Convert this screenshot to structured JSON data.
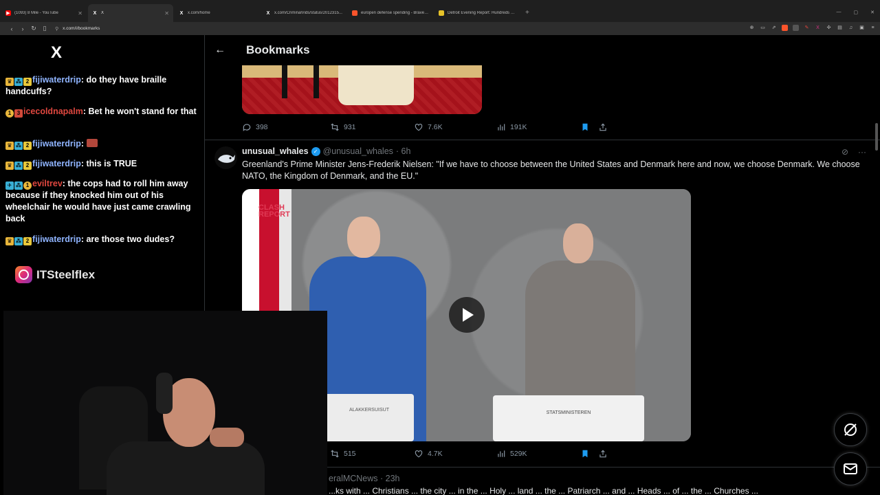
{
  "browser": {
    "tabs": [
      {
        "title": "(1093) 8 Mile - YouTube",
        "icon": "youtube-icon",
        "color": "#ff0000",
        "active": false
      },
      {
        "title": "X",
        "icon": "x-icon",
        "color": "#000000",
        "active": true
      },
      {
        "title": "x.com/home",
        "icon": "x-icon",
        "color": "#000000",
        "active": false
      },
      {
        "title": "x.com/CriminalVids/status/2012315...",
        "icon": "x-icon",
        "color": "#000000",
        "active": false
      },
      {
        "title": "europen defense spending - Brave S...",
        "icon": "brave-search-icon",
        "color": "#fb542b",
        "active": false
      },
      {
        "title": "Detroit Evening Report: Hundreds in...",
        "icon": "news-icon",
        "color": "#e6c229",
        "active": false
      }
    ],
    "url": "x.com/i/bookmarks"
  },
  "chat": {
    "logo": "X",
    "messages": [
      {
        "user": "fijiwaterdrip",
        "user_color": "blue",
        "text": ": do they have braille handcuffs?"
      },
      {
        "user": "icecoldnapalm",
        "user_color": "red",
        "text": ": Bet he won't stand for that"
      },
      {
        "user": "fijiwaterdrip",
        "user_color": "blue",
        "text": ":"
      },
      {
        "user": "fijiwaterdrip",
        "user_color": "blue",
        "text": ": this is TRUE"
      },
      {
        "user": "eviltrev",
        "user_color": "red",
        "text": ": the cops had to roll him away because if they knocked him out of his wheelchair he would have just came crawling back"
      },
      {
        "user": "fijiwaterdrip",
        "user_color": "blue",
        "text": ": are those two dudes?"
      }
    ],
    "instagram_handle": "ITSteelflex"
  },
  "feed": {
    "title": "Bookmarks",
    "previous_tweet": {
      "replies": "398",
      "reposts": "931",
      "likes": "7.6K",
      "views": "191K"
    },
    "tweet": {
      "display_name": "unusual_whales",
      "handle": "@unusual_whales",
      "time": "· 6h",
      "text": "Greenland's Prime Minister Jens-Frederik Nielsen: \"If we have to choose between the United States and Denmark here and now, we choose Denmark. We choose NATO, the Kingdom of Denmark, and the EU.\"",
      "video_logo_line1": "CLASH",
      "video_logo_line2": "REPORT",
      "podium_left": "ALAKKERSUISUT",
      "podium_right": "STATSMINISTEREN",
      "reposts": "515",
      "likes": "4.7K",
      "views": "529K"
    },
    "next_tweet": {
      "handle_fragment": "eralMCNews · 23h",
      "text_fragment": "...ks with ... Christians ... the city ... in the ... Holy ... land ... the ... Patriarch ... and ... Heads ... of ... the ... Churches ..."
    }
  },
  "colors": {
    "accent": "#1d9bf0",
    "bookmark": "#1d9bf0",
    "muted": "#71767b"
  }
}
